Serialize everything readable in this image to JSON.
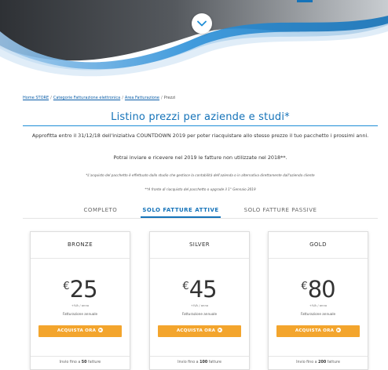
{
  "hero": {
    "scroll_icon": "chevron-down-icon"
  },
  "breadcrumb": [
    {
      "label": "Home STORE",
      "link": true
    },
    {
      "label": "Categorie Fatturazione elettronica",
      "link": true
    },
    {
      "label": "Area Fatturazione",
      "link": true
    },
    {
      "label": "Prezzi",
      "link": false
    }
  ],
  "page": {
    "title": "Listino prezzi per aziende e studi*",
    "promo_text": "Approfitta entro il 31/12/18 dell'iniziativa COUNTDOWN 2019 per poter riacquistare allo stesso prezzo il tuo pacchetto i prossimi anni.",
    "promo_text_2": "Potrai inviare e ricevere nel 2019 le fatture non utilizzate nel 2018**.",
    "note_1": "*L'acquisto del pacchetto è effettuato dallo studio che gestisce la contabilità dell'azienda o in alternativa direttamente dall'azienda cliente",
    "note_2": "**A fronte di riacquisto del pacchetto o upgrade il 1° Gennaio 2019"
  },
  "tabs": [
    {
      "label": "COMPLETO",
      "active": false
    },
    {
      "label": "SOLO FATTURE ATTIVE",
      "active": true
    },
    {
      "label": "SOLO FATTURE PASSIVE",
      "active": false
    }
  ],
  "plans": [
    {
      "name": "BRONZE",
      "currency": "€",
      "price": "25",
      "tax": "+IVA / anno",
      "billing": "Fatturazione annuale",
      "cta": "ACQUISTA ORA",
      "feature_prefix": "Invio fino a ",
      "feature_qty": "50",
      "feature_suffix": " fatture"
    },
    {
      "name": "SILVER",
      "currency": "€",
      "price": "45",
      "tax": "+IVA / anno",
      "billing": "Fatturazione annuale",
      "cta": "ACQUISTA ORA",
      "feature_prefix": "Invio fino a ",
      "feature_qty": "100",
      "feature_suffix": " fatture"
    },
    {
      "name": "GOLD",
      "currency": "€",
      "price": "80",
      "tax": "+IVA / anno",
      "billing": "Fatturazione annuale",
      "cta": "ACQUISTA ORA",
      "feature_prefix": "Invio fino a ",
      "feature_qty": "200",
      "feature_suffix": " fatture"
    }
  ],
  "colors": {
    "accent": "#1573b9",
    "cta": "#f3a52d",
    "hero_dark": "#3f4347",
    "hero_blue": "#2a8fd8"
  }
}
